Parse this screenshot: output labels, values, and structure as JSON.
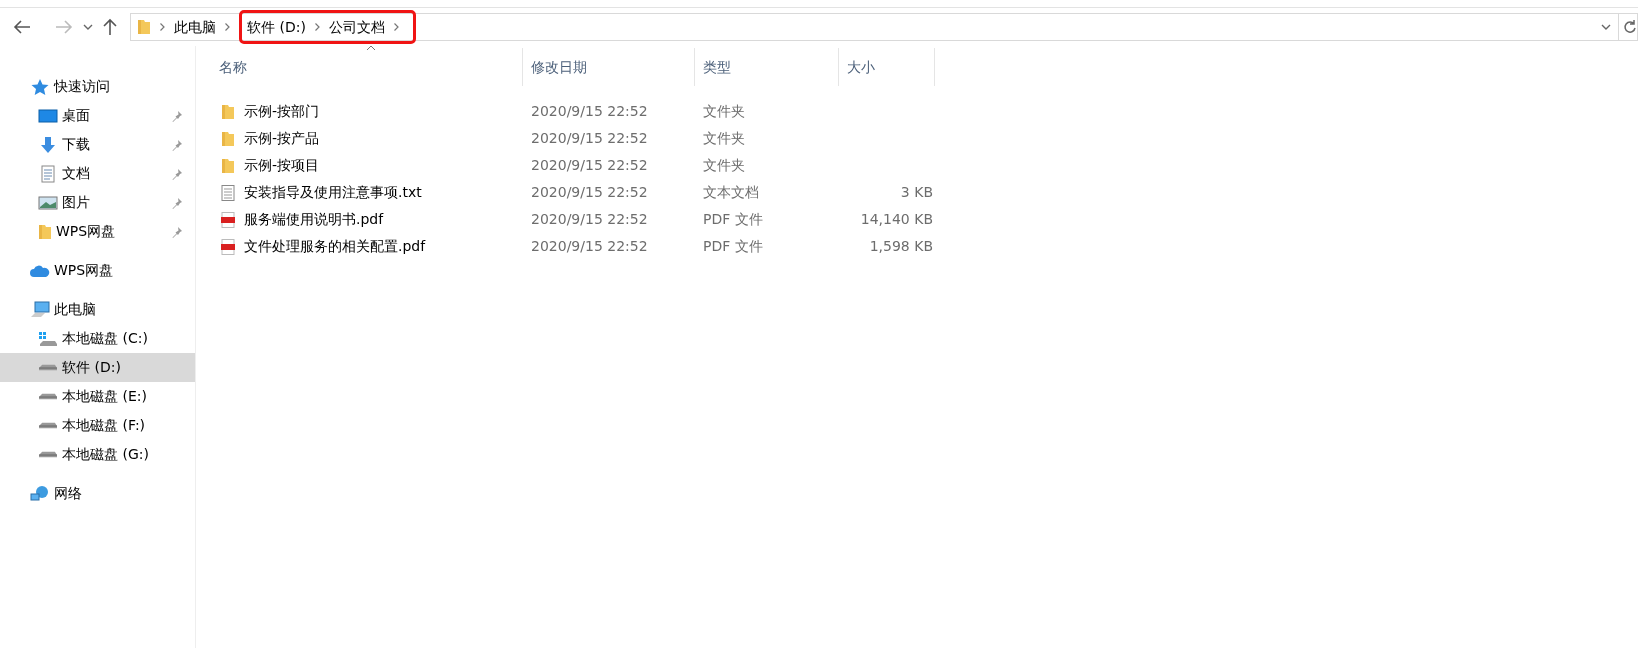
{
  "address_bar": {
    "crumbs": [
      {
        "label": "此电脑",
        "highlighted": false
      },
      {
        "label": "软件 (D:)",
        "highlighted": true
      },
      {
        "label": "公司文档",
        "highlighted": true
      }
    ]
  },
  "sidebar": {
    "sections": [
      {
        "label": "快速访问",
        "kind": "star",
        "selected": false,
        "children": [
          {
            "label": "桌面",
            "kind": "desktop",
            "pinned": true,
            "selected": false
          },
          {
            "label": "下载",
            "kind": "download",
            "pinned": true,
            "selected": false
          },
          {
            "label": "文档",
            "kind": "document",
            "pinned": true,
            "selected": false
          },
          {
            "label": "图片",
            "kind": "picture",
            "pinned": true,
            "selected": false
          },
          {
            "label": "WPS网盘",
            "kind": "folder",
            "pinned": true,
            "selected": false
          }
        ]
      },
      {
        "label": "WPS网盘",
        "kind": "cloud",
        "selected": false
      },
      {
        "label": "此电脑",
        "kind": "computer",
        "selected": false,
        "children": [
          {
            "label": "本地磁盘 (C:)",
            "kind": "system-drive",
            "pinned": false,
            "selected": false
          },
          {
            "label": "软件 (D:)",
            "kind": "drive",
            "pinned": false,
            "selected": true
          },
          {
            "label": "本地磁盘 (E:)",
            "kind": "drive",
            "pinned": false,
            "selected": false
          },
          {
            "label": "本地磁盘 (F:)",
            "kind": "drive",
            "pinned": false,
            "selected": false
          },
          {
            "label": "本地磁盘 (G:)",
            "kind": "drive",
            "pinned": false,
            "selected": false
          }
        ]
      },
      {
        "label": "网络",
        "kind": "network",
        "selected": false
      }
    ]
  },
  "file_list": {
    "columns": [
      {
        "label": "名称",
        "sorted": true
      },
      {
        "label": "修改日期",
        "sorted": false
      },
      {
        "label": "类型",
        "sorted": false
      },
      {
        "label": "大小",
        "sorted": false
      }
    ],
    "rows": [
      {
        "name": "示例-按部门",
        "kind": "folder",
        "modified": "2020/9/15 22:52",
        "type": "文件夹"
      },
      {
        "name": "示例-按产品",
        "kind": "folder",
        "modified": "2020/9/15 22:52",
        "type": "文件夹"
      },
      {
        "name": "示例-按项目",
        "kind": "folder",
        "modified": "2020/9/15 22:52",
        "type": "文件夹"
      },
      {
        "name": "安装指导及使用注意事项.txt",
        "kind": "text",
        "modified": "2020/9/15 22:52",
        "type": "文本文档",
        "size": "3 KB"
      },
      {
        "name": "服务端使用说明书.pdf",
        "kind": "pdf",
        "modified": "2020/9/15 22:52",
        "type": "PDF 文件",
        "size": "14,140 KB"
      },
      {
        "name": "文件处理服务的相关配置.pdf",
        "kind": "pdf",
        "modified": "2020/9/15 22:52",
        "type": "PDF 文件",
        "size": "1,598 KB"
      }
    ]
  }
}
